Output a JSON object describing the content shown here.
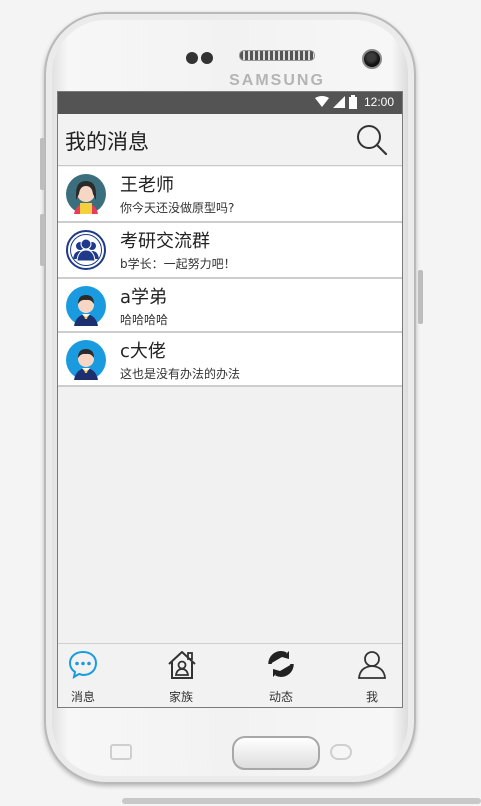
{
  "device": {
    "brand": "SAMSUNG"
  },
  "statusbar": {
    "time": "12:00",
    "icons": [
      "wifi-icon",
      "signal-icon",
      "battery-icon"
    ]
  },
  "header": {
    "title": "我的消息",
    "search_icon": "search-icon"
  },
  "messages": [
    {
      "name": "王老师",
      "preview": "你今天还没做原型吗?",
      "avatar": "female-avatar"
    },
    {
      "name": "考研交流群",
      "preview": "b学长：一起努力吧！",
      "avatar": "group-avatar"
    },
    {
      "name": "a学弟",
      "preview": "哈哈哈哈",
      "avatar": "male-avatar"
    },
    {
      "name": "c大佬",
      "preview": "这也是没有办法的办法",
      "avatar": "male-avatar"
    }
  ],
  "tabbar": {
    "tabs": [
      {
        "label": "消息",
        "icon": "chat-icon",
        "active": true
      },
      {
        "label": "家族",
        "icon": "home-icon",
        "active": false
      },
      {
        "label": "动态",
        "icon": "refresh-icon",
        "active": false
      },
      {
        "label": "我",
        "icon": "user-icon",
        "active": false
      }
    ]
  },
  "colors": {
    "accent": "#1a9be0",
    "statusbar": "#545454"
  }
}
